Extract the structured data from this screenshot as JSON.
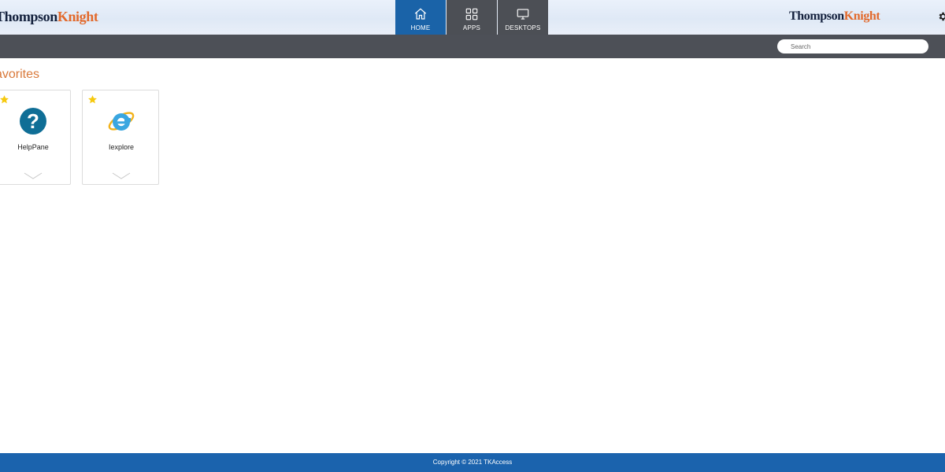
{
  "header": {
    "logo_left": {
      "part1": "Thompson",
      "part2": "Knight"
    },
    "logo_right": {
      "part1": "Thompson",
      "part2": "Knight"
    },
    "tabs": [
      {
        "label": "HOME",
        "icon": "home-icon",
        "active": true
      },
      {
        "label": "APPS",
        "icon": "apps-grid-icon",
        "active": false
      },
      {
        "label": "DESKTOPS",
        "icon": "monitor-icon",
        "active": false
      }
    ],
    "settings_icon": "gear-icon"
  },
  "toolbar": {
    "search_placeholder": "Search"
  },
  "favorites": {
    "title": "avorites",
    "apps": [
      {
        "name": "HelpPane",
        "icon": "help-question-icon",
        "favorite": true
      },
      {
        "name": "Iexplore",
        "icon": "internet-explorer-icon",
        "favorite": true
      }
    ]
  },
  "footer": {
    "text": "Copyright © 2021 TKAccess"
  },
  "colors": {
    "active_tab": "#1a63a8",
    "tab": "#4c4f55",
    "toolbar": "#4d5057",
    "footer": "#1b63ad",
    "accent_orange": "#e2692b",
    "logo_navy": "#14213d",
    "star": "#f6c90e"
  }
}
